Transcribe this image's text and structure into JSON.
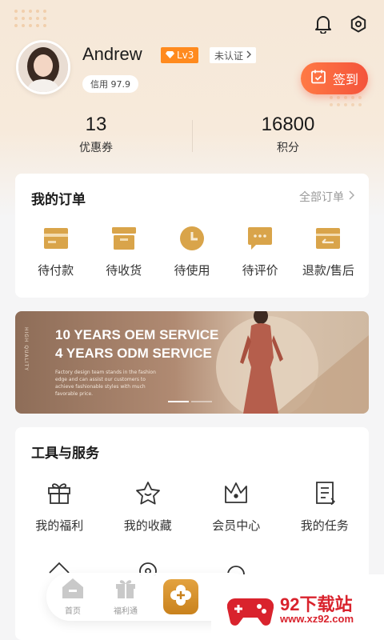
{
  "profile": {
    "username": "Andrew",
    "level": "Lv3",
    "verify_status": "未认证",
    "credit_label": "信用",
    "credit_score": "97.9"
  },
  "checkin": {
    "label": "签到"
  },
  "stats": [
    {
      "value": "13",
      "label": "优惠券"
    },
    {
      "value": "16800",
      "label": "积分"
    }
  ],
  "orders": {
    "title": "我的订单",
    "more": "全部订单",
    "items": [
      {
        "label": "待付款",
        "icon": "wallet-icon"
      },
      {
        "label": "待收货",
        "icon": "box-icon"
      },
      {
        "label": "待使用",
        "icon": "clock-icon"
      },
      {
        "label": "待评价",
        "icon": "comment-icon"
      },
      {
        "label": "退款/售后",
        "icon": "refund-icon"
      }
    ]
  },
  "banner": {
    "line1": "10 YEARS OEM SERVICE",
    "line2": "4 YEARS ODM SERVICE",
    "desc": "Factory design team stands in the fashion edge and can assist our customers to achieve fashionable styles with much favorable price.",
    "side": "HIGH QUALITY",
    "slides": 2,
    "active_slide": 1
  },
  "tools": {
    "title": "工具与服务",
    "items": [
      {
        "label": "我的福利",
        "icon": "gift-icon"
      },
      {
        "label": "我的收藏",
        "icon": "star-icon"
      },
      {
        "label": "会员中心",
        "icon": "crown-icon"
      },
      {
        "label": "我的任务",
        "icon": "task-icon"
      }
    ]
  },
  "tabbar": [
    {
      "label": "首页",
      "icon": "home-icon"
    },
    {
      "label": "福利通",
      "icon": "gift-tab-icon"
    }
  ],
  "watermark": {
    "text": "92下载站",
    "url": "www.xz92.com"
  },
  "colors": {
    "accent": "#ff8a1e",
    "checkin": "#f4533b",
    "icon_gold": "#d9a44a"
  }
}
